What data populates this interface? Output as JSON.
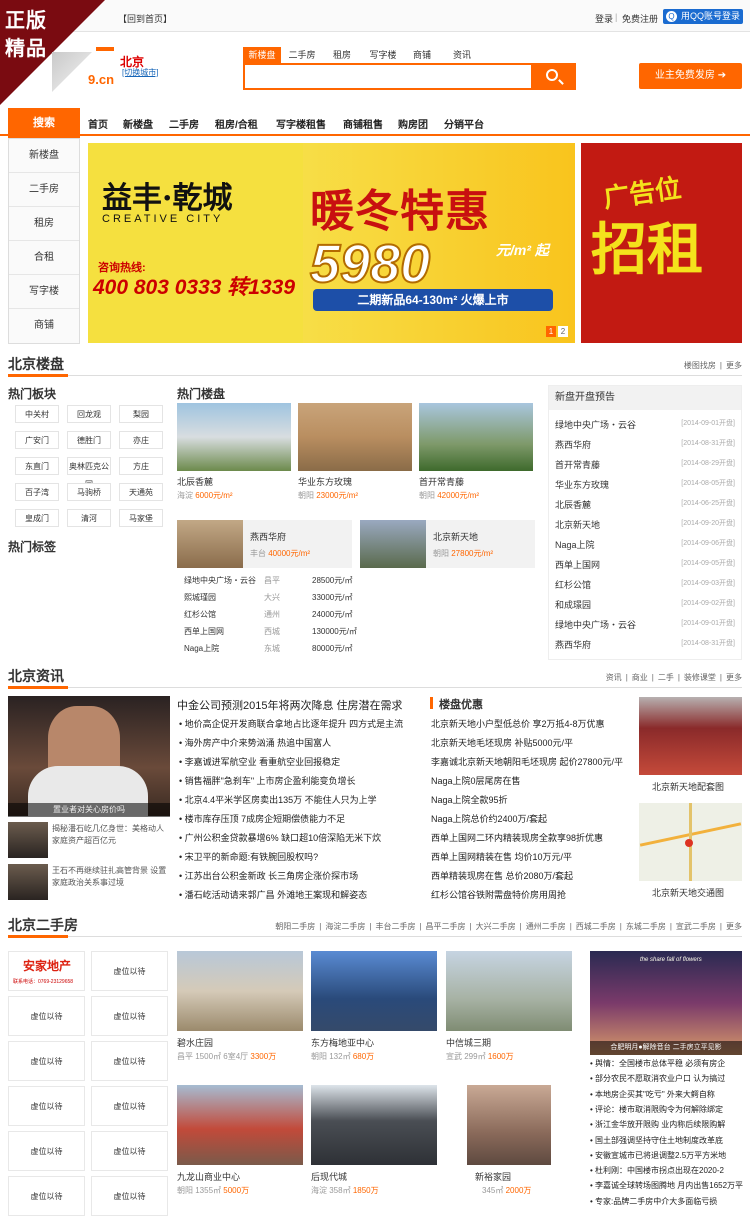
{
  "ribbon": {
    "line1": "正版",
    "line2": "精品"
  },
  "topbar": {
    "home": "【回到首页】",
    "login": "登录",
    "register": "免费注册",
    "qq": "用QQ账号登录"
  },
  "header": {
    "logo_domain": "9.cn",
    "city": "北京",
    "switch_city": "[切换城市]",
    "publish": "业主免费发房"
  },
  "search": {
    "tabs": [
      "新楼盘",
      "二手房",
      "租房",
      "写字楼",
      "商铺",
      "资讯"
    ],
    "placeholder": ""
  },
  "nav": {
    "search_label": "搜索",
    "items": [
      "首页",
      "新楼盘",
      "二手房",
      "租房/合租",
      "写字楼租售",
      "商铺租售",
      "购房团",
      "分销平台"
    ]
  },
  "left_menu": [
    "新楼盘",
    "二手房",
    "租房",
    "合租",
    "写字楼",
    "商铺"
  ],
  "banner": {
    "brand": "益丰·乾城",
    "brand_en": "CREATIVE CITY",
    "hotline_label": "咨询热线:",
    "phone": "400 803 0333 转1339",
    "promo": "暖冬特惠",
    "price": "5980",
    "price_unit": "元/m² 起",
    "strip": "二期新品64-130m² 火爆上市",
    "pages": [
      "1",
      "2"
    ],
    "ad1": "广告位",
    "ad2": "招租"
  },
  "sec_newhouse": {
    "title": "北京楼盘",
    "links": [
      "楼图找房",
      "更多"
    ]
  },
  "hot_blocks": {
    "title": "热门板块",
    "items": [
      "中关村",
      "回龙观",
      "梨园",
      "广安门",
      "德胜门",
      "亦庄",
      "东直门",
      "奥林匹克公园",
      "方庄",
      "百子湾",
      "马驹桥",
      "天通苑",
      "皇成门",
      "清河",
      "马家堡"
    ]
  },
  "hot_tags": {
    "title": "热门标签"
  },
  "hot_estates": {
    "title": "热门楼盘",
    "row1": [
      {
        "name": "北辰香麓",
        "area": "海淀",
        "price": "6000元/m²"
      },
      {
        "name": "华业东方玫瑰",
        "area": "朝阳",
        "price": "23000元/m²"
      },
      {
        "name": "首开常青藤",
        "area": "朝阳",
        "price": "42000元/m²"
      }
    ],
    "row2": [
      {
        "name": "燕西华府",
        "area": "丰台",
        "price": "40000元/m²"
      },
      {
        "name": "北京新天地",
        "area": "朝阳",
        "price": "27800元/m²"
      }
    ],
    "table": [
      [
        "绿地中央广场・云谷",
        "昌平",
        "28500元/㎡"
      ],
      [
        "熙城瑾园",
        "大兴",
        "33000元/㎡"
      ],
      [
        "红杉公馆",
        "通州",
        "24000元/㎡"
      ],
      [
        "西单上国网",
        "西城",
        "130000元/㎡"
      ],
      [
        "Naga上院",
        "东城",
        "80000元/㎡"
      ]
    ]
  },
  "new_open": {
    "title": "新盘开盘预告",
    "items": [
      [
        "绿地中央广场・云谷",
        "[2014-09-01开盘]"
      ],
      [
        "燕西华府",
        "[2014-08-31开盘]"
      ],
      [
        "首开常青藤",
        "[2014-08-29开盘]"
      ],
      [
        "华业东方玫瑰",
        "[2014-08-05开盘]"
      ],
      [
        "北辰香麓",
        "[2014-06-25开盘]"
      ],
      [
        "北京新天地",
        "[2014-09-20开盘]"
      ],
      [
        "Naga上院",
        "[2014-09-06开盘]"
      ],
      [
        "西单上国网",
        "[2014-09-05开盘]"
      ],
      [
        "红杉公馆",
        "[2014-09-03开盘]"
      ],
      [
        "和成璟园",
        "[2014-09-02开盘]"
      ],
      [
        "绿地中央广场・云谷",
        "[2014-09-01开盘]"
      ],
      [
        "燕西华府",
        "[2014-08-31开盘]"
      ]
    ]
  },
  "sec_news": {
    "title": "北京资讯",
    "links": [
      "资讯",
      "商业",
      "二手",
      "装修课堂",
      "更多"
    ]
  },
  "news": {
    "big_caption": "置业者对关心房价吗",
    "side": [
      {
        "text": "揭秘潘石屹几亿身世：美格动人 家庭资产超百亿元"
      },
      {
        "text": "王石不再继续驻扎高管背景 设置家庭政治关系事过境"
      }
    ],
    "headline": "中金公司预测2015年将两次降息 住房潜在需求",
    "list": [
      "地价高企促开发商联合拿地占比逐年提升 四方式是主流",
      "海外房产中介来势汹涌 热追中国富人",
      "李嘉诚进军航空业 看重航空业回报稳定",
      "销售福胖\"急刹车\" 上市房企盈利能变负增长",
      "北京4.4平米学区房卖出135万 不能住人只为上学",
      "楼市库存压顶 7成房企短期偿债能力不足",
      "广州公积金贷款暴增6% 缺口超10倍深陷无米下炊",
      "宋卫平的新命题:有铁腕回股权吗?",
      "江苏出台公积金新政 长三角房企涨价探市场",
      "潘石屹活动请来郭广昌 外滩地王案现和解姿态"
    ],
    "deals_title": "楼盘优惠",
    "deals": [
      "北京新天地小户型低总价 享2万抵4-8万优惠",
      "北京新天地毛坯现房 补贴5000元/平",
      "李嘉诚北京新天地朝阳毛坯现房 起价27800元/平",
      "Naga上院0层尾房在售",
      "Naga上院全款95折",
      "Naga上院总价约2400万/套起",
      "西单上国网二环内精装现房全款享98折优惠",
      "西单上国网精装在售 均价10万元/平",
      "西单精装现房在售 总价2080万/套起",
      "红杉公馆谷铁附需盘特价房用周抢"
    ],
    "right": [
      {
        "cap": "北京新天地配套图"
      },
      {
        "cap": "北京新天地交通图"
      }
    ]
  },
  "sec_second": {
    "title": "北京二手房",
    "links": [
      "朝阳二手房",
      "海淀二手房",
      "丰台二手房",
      "昌平二手房",
      "大兴二手房",
      "通州二手房",
      "西城二手房",
      "东城二手房",
      "宣武二手房",
      "更多"
    ]
  },
  "second": {
    "agency_logo": "安家地产",
    "agency_phone": "联系电话：0769-23129658",
    "placeholder": "虚位以待",
    "row1": [
      {
        "name": "碧水庄园",
        "area": "昌平",
        "size": "1500㎡",
        "layout": "6室4厅",
        "price": "3300万"
      },
      {
        "name": "东方梅地亚中心",
        "area": "朝阳",
        "size": "132㎡",
        "price": "680万"
      },
      {
        "name": "中信城三期",
        "area": "宣武",
        "size": "299㎡",
        "price": "1600万"
      }
    ],
    "row2": [
      {
        "name": "九龙山商业中心",
        "area": "朝阳",
        "size": "1355㎡",
        "price": "5000万"
      },
      {
        "name": "后现代城",
        "area": "海淀",
        "size": "358㎡",
        "price": "1850万"
      },
      {
        "name": "新裕家园",
        "size": "345㎡",
        "price": "2000万"
      }
    ],
    "ad_caption": "合肥明月●解除音台 二手房立平见影",
    "ad_title": "the share fall of flowers",
    "right_list": [
      "舆情：全国楼市总体平稳 必须有房企",
      "部分农民不愿取消农业户口 认为搞过",
      "本地房企买其\"吃亏\" 外来大鳄自称",
      "评论：楼市取消限购令为何解除绑定",
      "浙江金华放开限购 业内称后续限购解",
      "国土部强调坚持守住土地制度改革底",
      "安徽宣城市已将退调整2.5万平方米地",
      "杜利刚：中国楼市拐点出现在2020-2",
      "李嘉诚全球转场图腾地 月内出售1652万平",
      "专家:品牌二手房中介大多面临亏损"
    ]
  },
  "colors": {
    "accent": "#ff6600",
    "ribbon": "#7a0b11",
    "link": "#1665b8"
  }
}
